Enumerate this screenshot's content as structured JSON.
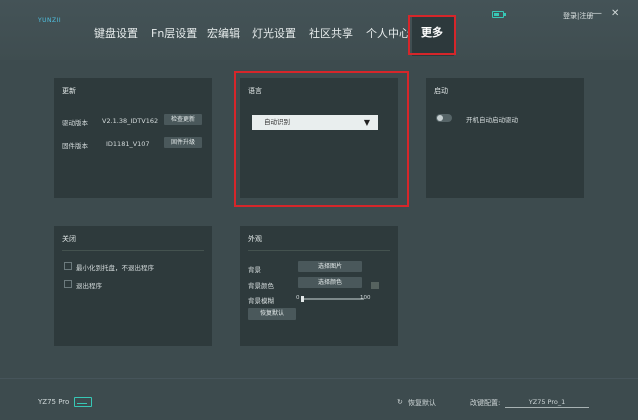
{
  "app": {
    "logo": "YUNZII",
    "login": "登录|注册"
  },
  "nav": {
    "items": [
      "键盘设置",
      "Fn层设置",
      "宏编辑",
      "灯光设置",
      "社区共享",
      "个人中心"
    ],
    "active": "更多"
  },
  "window_controls": {
    "minimize": "—",
    "close": "✕"
  },
  "update": {
    "title": "更新",
    "driver_label": "驱动版本",
    "driver_version": "V2.1.38_IDTV162",
    "check_update": "检查更新",
    "firmware_label": "固件版本",
    "firmware_version": "ID1181_V107",
    "firmware_upgrade": "固件升级"
  },
  "language": {
    "title": "语言",
    "selected": "自动识别",
    "arrow": "▼"
  },
  "startup": {
    "title": "启动",
    "autostart_label": "开机自动启动驱动",
    "autostart_on": false
  },
  "close_panel": {
    "title": "关闭",
    "minimize_tray": "最小化到托盘，不退出程序",
    "exit_program": "退出程序"
  },
  "appearance": {
    "title": "外观",
    "background_label": "背景",
    "select_image": "选择图片",
    "background_color_label": "背景颜色",
    "select_color": "选择颜色",
    "blur_label": "背景模糊",
    "blur_min": "0",
    "blur_max": "100",
    "blur_value": 0,
    "restore_default": "恢复默认"
  },
  "footer": {
    "model": "YZ75 Pro",
    "restore_default": "恢复默认",
    "profile_label": "改键配置:",
    "profile_value": "YZ75 Pro_1"
  },
  "colors": {
    "accent": "#37c8b6",
    "highlight": "#d6262a",
    "background": "#3d4b4e",
    "panel": "#2e3a3c"
  }
}
